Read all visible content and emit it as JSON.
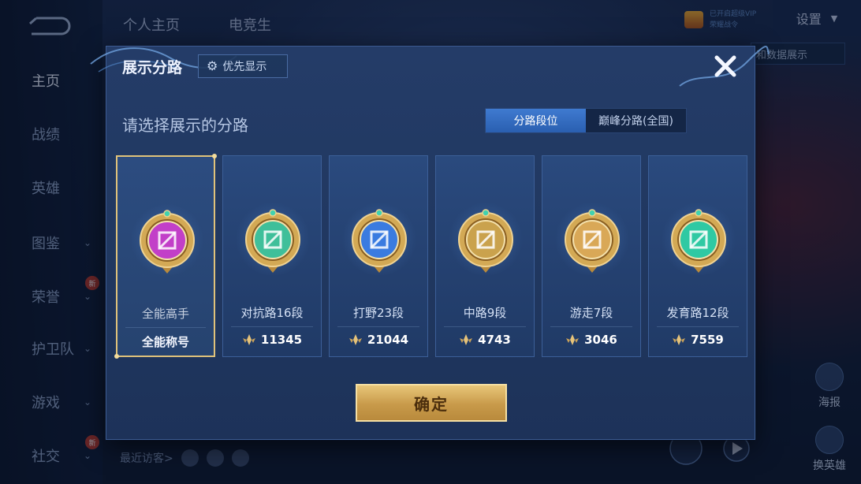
{
  "background": {
    "top_tabs": [
      "个人主页",
      "电竞生"
    ],
    "settings_label": "设置",
    "data_show_label": "和数据展示",
    "vip_lines": [
      "已开启超级VIP",
      "荣耀战令"
    ],
    "side_buttons": [
      "海报",
      "换英雄"
    ],
    "visitors_label": "最近访客>"
  },
  "nav": {
    "items": [
      {
        "label": "主页",
        "has_chevron": false,
        "is_new": false
      },
      {
        "label": "战绩",
        "has_chevron": false,
        "is_new": false
      },
      {
        "label": "英雄",
        "has_chevron": false,
        "is_new": false
      },
      {
        "label": "图鉴",
        "has_chevron": true,
        "is_new": false
      },
      {
        "label": "荣誉",
        "has_chevron": true,
        "is_new": true
      },
      {
        "label": "护卫队",
        "has_chevron": true,
        "is_new": false
      },
      {
        "label": "游戏",
        "has_chevron": true,
        "is_new": false
      },
      {
        "label": "社交",
        "has_chevron": true,
        "is_new": true
      }
    ],
    "new_badge_label": "新"
  },
  "modal": {
    "title": "展示分路",
    "priority_label": "优先显示",
    "prompt": "请选择展示的分路",
    "segments": [
      "分路段位",
      "巅峰分路(全国)"
    ],
    "active_segment": 0,
    "confirm_label": "确定"
  },
  "cards": [
    {
      "name": "全能高手",
      "tag": "全能称号",
      "score": "",
      "emblem": "all-round-emblem",
      "color": "#c23fc8",
      "selected": true
    },
    {
      "name": "对抗路16段",
      "tag": "",
      "score": "11345",
      "emblem": "clash-lane-emblem",
      "color": "#3fbf9a",
      "selected": false
    },
    {
      "name": "打野23段",
      "tag": "",
      "score": "21044",
      "emblem": "jungle-emblem",
      "color": "#3a7be0",
      "selected": false
    },
    {
      "name": "中路9段",
      "tag": "",
      "score": "4743",
      "emblem": "mid-lane-emblem",
      "color": "#caa24d",
      "selected": false
    },
    {
      "name": "游走7段",
      "tag": "",
      "score": "3046",
      "emblem": "roam-emblem",
      "color": "#d9a857",
      "selected": false
    },
    {
      "name": "发育路12段",
      "tag": "",
      "score": "7559",
      "emblem": "farm-lane-emblem",
      "color": "#2fc9a3",
      "selected": false
    }
  ],
  "colors": {
    "accent_gold": "#e0c27a",
    "segment_active": "#3f7ad0",
    "modal_bg": "#223a65"
  }
}
